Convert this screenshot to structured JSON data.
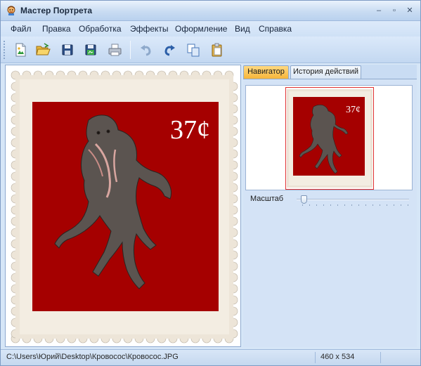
{
  "window": {
    "title": "Мастер Портрета",
    "icon": "app-portrait-icon"
  },
  "menu": [
    "Файл",
    "Правка",
    "Обработка",
    "Эффекты",
    "Оформление",
    "Вид",
    "Справка"
  ],
  "toolbar": {
    "buttons": [
      "new-image-icon",
      "open-folder-icon",
      "save-icon",
      "save-as-icon",
      "print-icon",
      "undo-icon",
      "redo-icon",
      "copy-icon",
      "paste-icon"
    ]
  },
  "canvas": {
    "price": "37¢",
    "stamp_color": "#a80000",
    "stamp_border": "#ece3d6"
  },
  "panel": {
    "tabs": [
      "Навигатор",
      "История действий"
    ],
    "active_tab": "Навигатор",
    "zoom_label": "Масштаб",
    "zoom_level": 0.02
  },
  "status": {
    "path": "C:\\Users\\Юрий\\Desktop\\Кровосос\\Кровосос.JPG",
    "size": "460 x 534"
  }
}
